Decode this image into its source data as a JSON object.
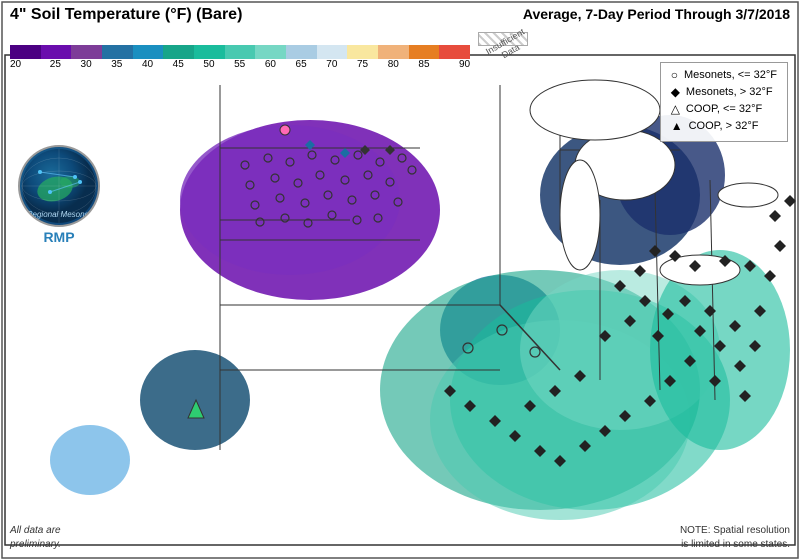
{
  "title": "4\" Soil Temperature (°F) (Bare)",
  "subtitle": "Average, 7-Day Period Through 3/7/2018",
  "colorbar": {
    "labels": [
      "20",
      "25",
      "30",
      "35",
      "40",
      "45",
      "50",
      "55",
      "60",
      "65",
      "70",
      "75",
      "80",
      "85",
      "90"
    ],
    "colors": [
      "#4b0082",
      "#6a0dad",
      "#800080",
      "#9b59b6",
      "#5b2c8a",
      "#2471a3",
      "#1a8fc0",
      "#17a589",
      "#1abc9c",
      "#48c9b0",
      "#a9cce3",
      "#f9e79f",
      "#f0b27a",
      "#e67e22",
      "#e74c3c"
    ]
  },
  "insuff_label": "Insufficient\nData",
  "legend": {
    "items": [
      {
        "symbol": "○",
        "label": "Mesonets, <= 32°F"
      },
      {
        "symbol": "◆",
        "label": "Mesonets, > 32°F"
      },
      {
        "symbol": "△",
        "label": "COOP, <= 32°F"
      },
      {
        "symbol": "▲",
        "label": "COOP, > 32°F"
      }
    ]
  },
  "footer_left": "All data are\npreliminary.",
  "footer_right": "NOTE: Spatial resolution\nis limited in some states."
}
